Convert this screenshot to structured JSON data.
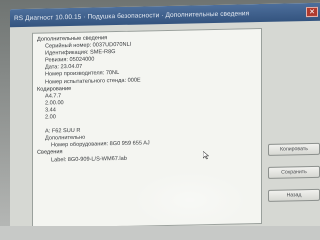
{
  "window": {
    "title": "RS Диагност 10.00.15 · Подушка безопасности · Дополнительные сведения",
    "close_glyph": "✕"
  },
  "panel": {
    "heading": "Дополнительные сведения",
    "serial": "Серийный номер: 0037UD070NLI",
    "ident": "Идентификация: SME-R8G",
    "revision": "Ревизия: 05024000",
    "date": "Дата: 23.04.07",
    "manufacturer": "Номер производителя: 70NL",
    "test_stand": "Номер испытательного стенда: 000E",
    "coding_label": "Кодирование",
    "coding_1": "A4.7.7",
    "coding_2": "2.00.00",
    "coding_3": "3.44",
    "coding_4": "2.00",
    "part_line": "A: F62 SUU R",
    "extra_label": "Дополнительно",
    "equipment_no": "Номер оборудования: 8G0 959 655 AJ",
    "info_label": "Сведения",
    "label_line": "Label: 8G0-909-L/S-WM67.lab"
  },
  "buttons": {
    "copy": "Копировать",
    "save": "Сохранить",
    "back": "Назад"
  },
  "icons": {
    "cursor": "mouse-pointer-icon"
  }
}
